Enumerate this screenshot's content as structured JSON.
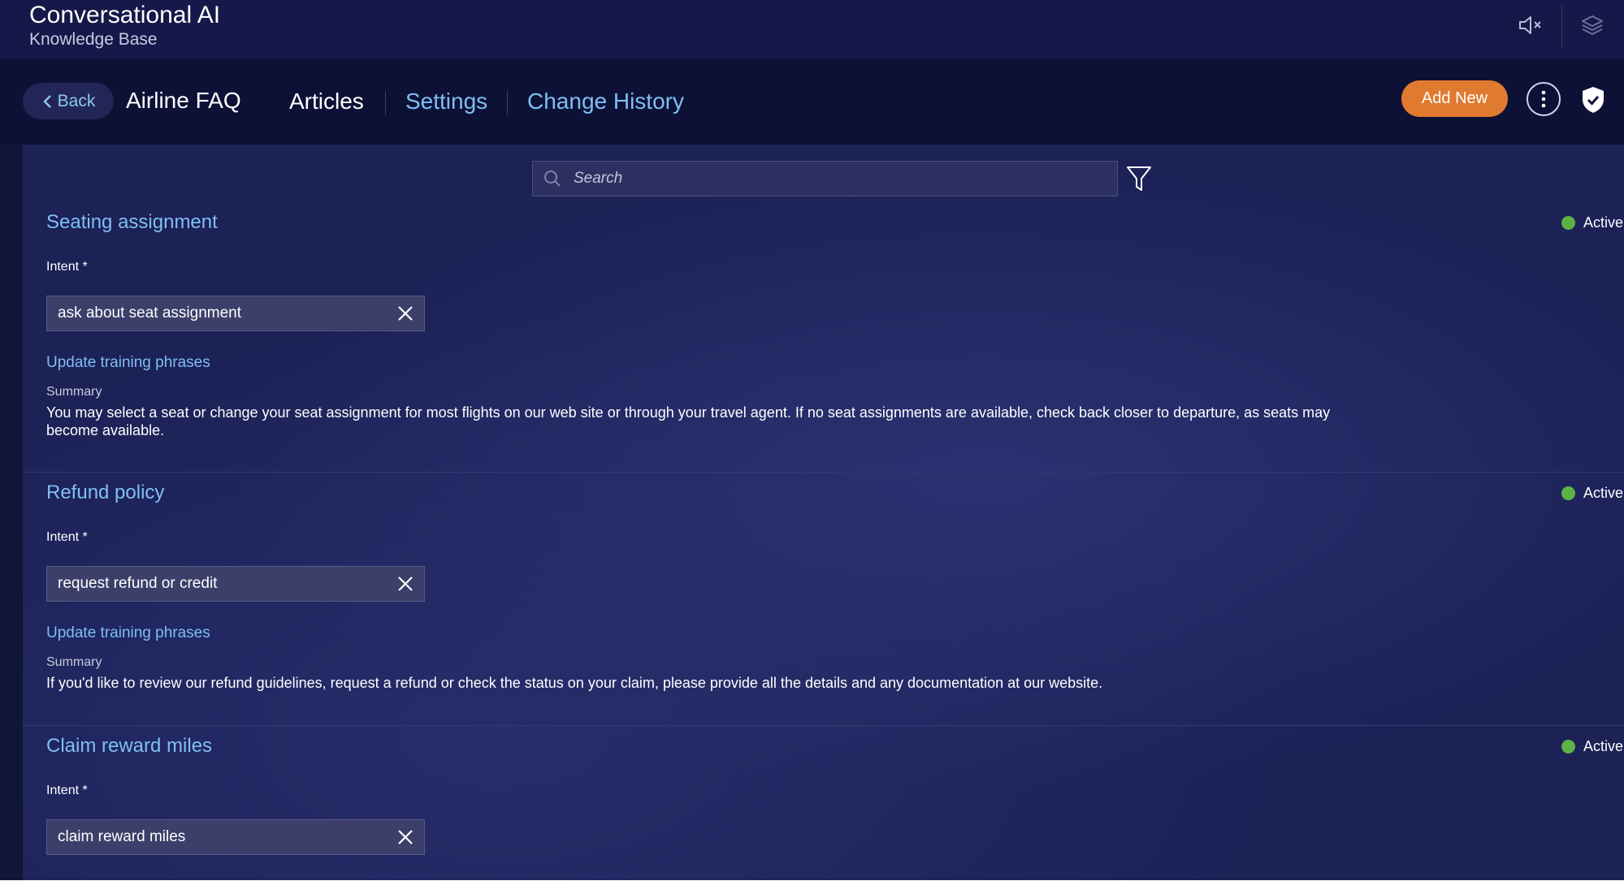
{
  "app": {
    "title": "Conversational AI",
    "subtitle": "Knowledge Base"
  },
  "topbar_icons": [
    "speaker-mute-icon",
    "layers-icon"
  ],
  "nav": {
    "back_label": "Back",
    "kb_name": "Airline FAQ",
    "tabs": [
      {
        "label": "Articles",
        "active": true
      },
      {
        "label": "Settings",
        "active": false
      },
      {
        "label": "Change History",
        "active": false
      }
    ],
    "add_new_label": "Add New"
  },
  "search": {
    "placeholder": "Search"
  },
  "articles": [
    {
      "title": "Seating assignment",
      "status": "Active",
      "intent_label": "Intent *",
      "intent_value": "ask about seat assignment",
      "training_link": "Update training phrases",
      "summary_label": "Summary",
      "summary": "You may select a seat or change your seat assignment for most flights on our web site or through your travel agent. If no seat assignments are available, check back closer to departure, as seats may become available."
    },
    {
      "title": "Refund policy",
      "status": "Active",
      "intent_label": "Intent *",
      "intent_value": "request refund or credit",
      "training_link": "Update training phrases",
      "summary_label": "Summary",
      "summary": "If you'd like to review our refund guidelines, request a refund or check the status on your claim, please provide all the details and any documentation at our website."
    },
    {
      "title": "Claim reward miles",
      "status": "Active",
      "intent_label": "Intent *",
      "intent_value": "claim reward miles"
    }
  ],
  "colors": {
    "accent_link": "#7fbff2",
    "add_button": "#e07a2f",
    "status_active": "#5db246",
    "panel_bg": "#1c2156",
    "topbar_bg": "#151848"
  }
}
